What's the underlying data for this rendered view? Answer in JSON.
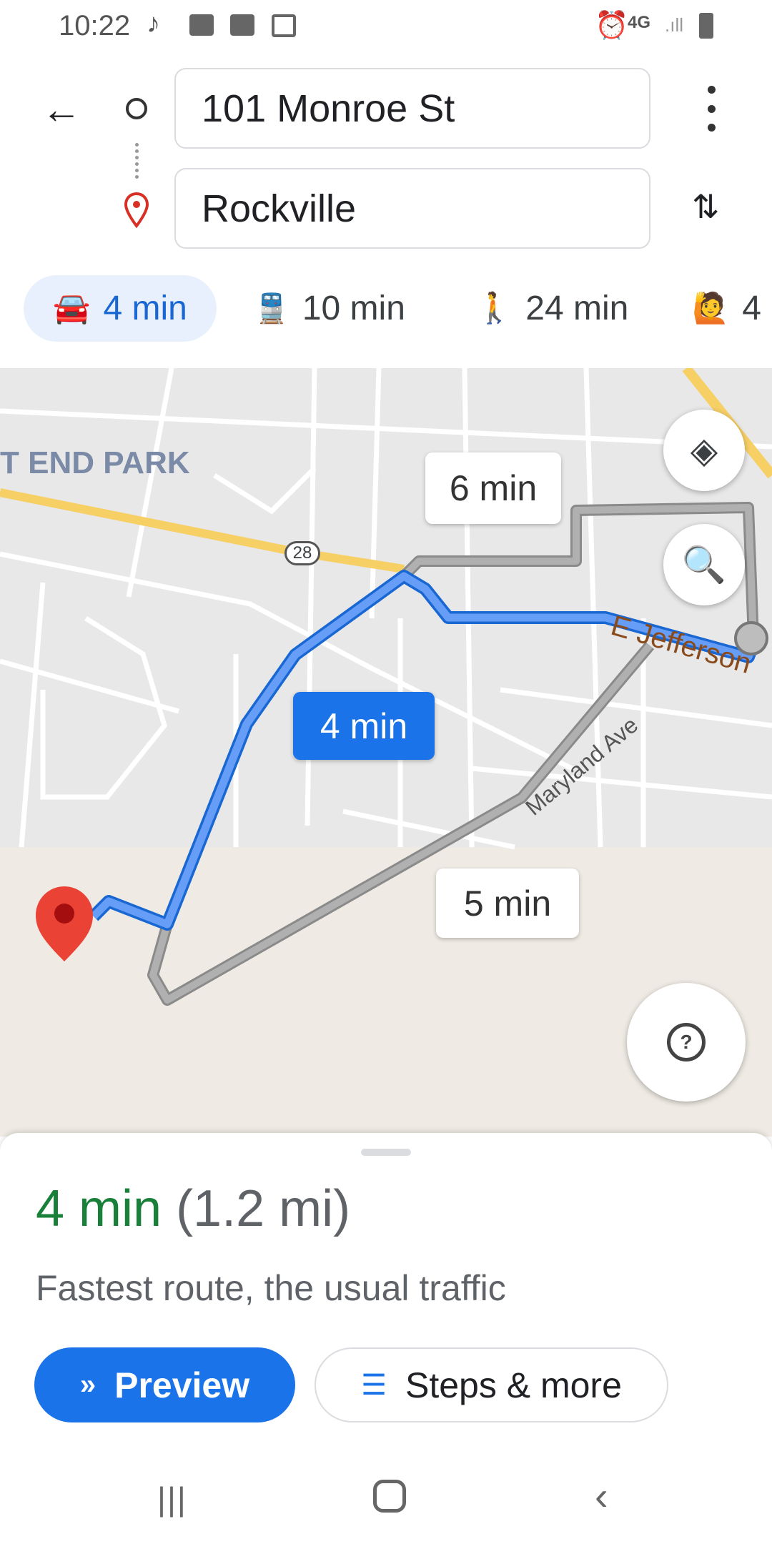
{
  "status_bar": {
    "time": "10:22",
    "network": "4G"
  },
  "directions": {
    "origin": "101 Monroe St",
    "destination": "Rockville"
  },
  "travel_modes": [
    {
      "mode": "driving",
      "icon": "car-icon",
      "label": "4 min",
      "selected": true
    },
    {
      "mode": "transit",
      "icon": "train-icon",
      "label": "10 min"
    },
    {
      "mode": "walking",
      "icon": "walking-icon",
      "label": "24 min"
    },
    {
      "mode": "rideshare",
      "icon": "ride-hail-icon",
      "label": "4"
    }
  ],
  "map": {
    "labels": {
      "park": "T END PARK",
      "route_shield": "28",
      "street1": "E Jefferson",
      "street2": "Maryland Ave"
    },
    "route_bubbles": {
      "selected": "4 min",
      "alt1": "6 min",
      "alt2": "5 min"
    },
    "colors": {
      "selected_route": "#4285f4",
      "alt_route": "#a0a0a0",
      "destination_pin": "#ea4335"
    }
  },
  "summary": {
    "duration": "4 min",
    "distance": "(1.2 mi)",
    "description": "Fastest route, the usual traffic",
    "preview_label": "Preview",
    "steps_label": "Steps & more",
    "duration_color": "#188038"
  }
}
